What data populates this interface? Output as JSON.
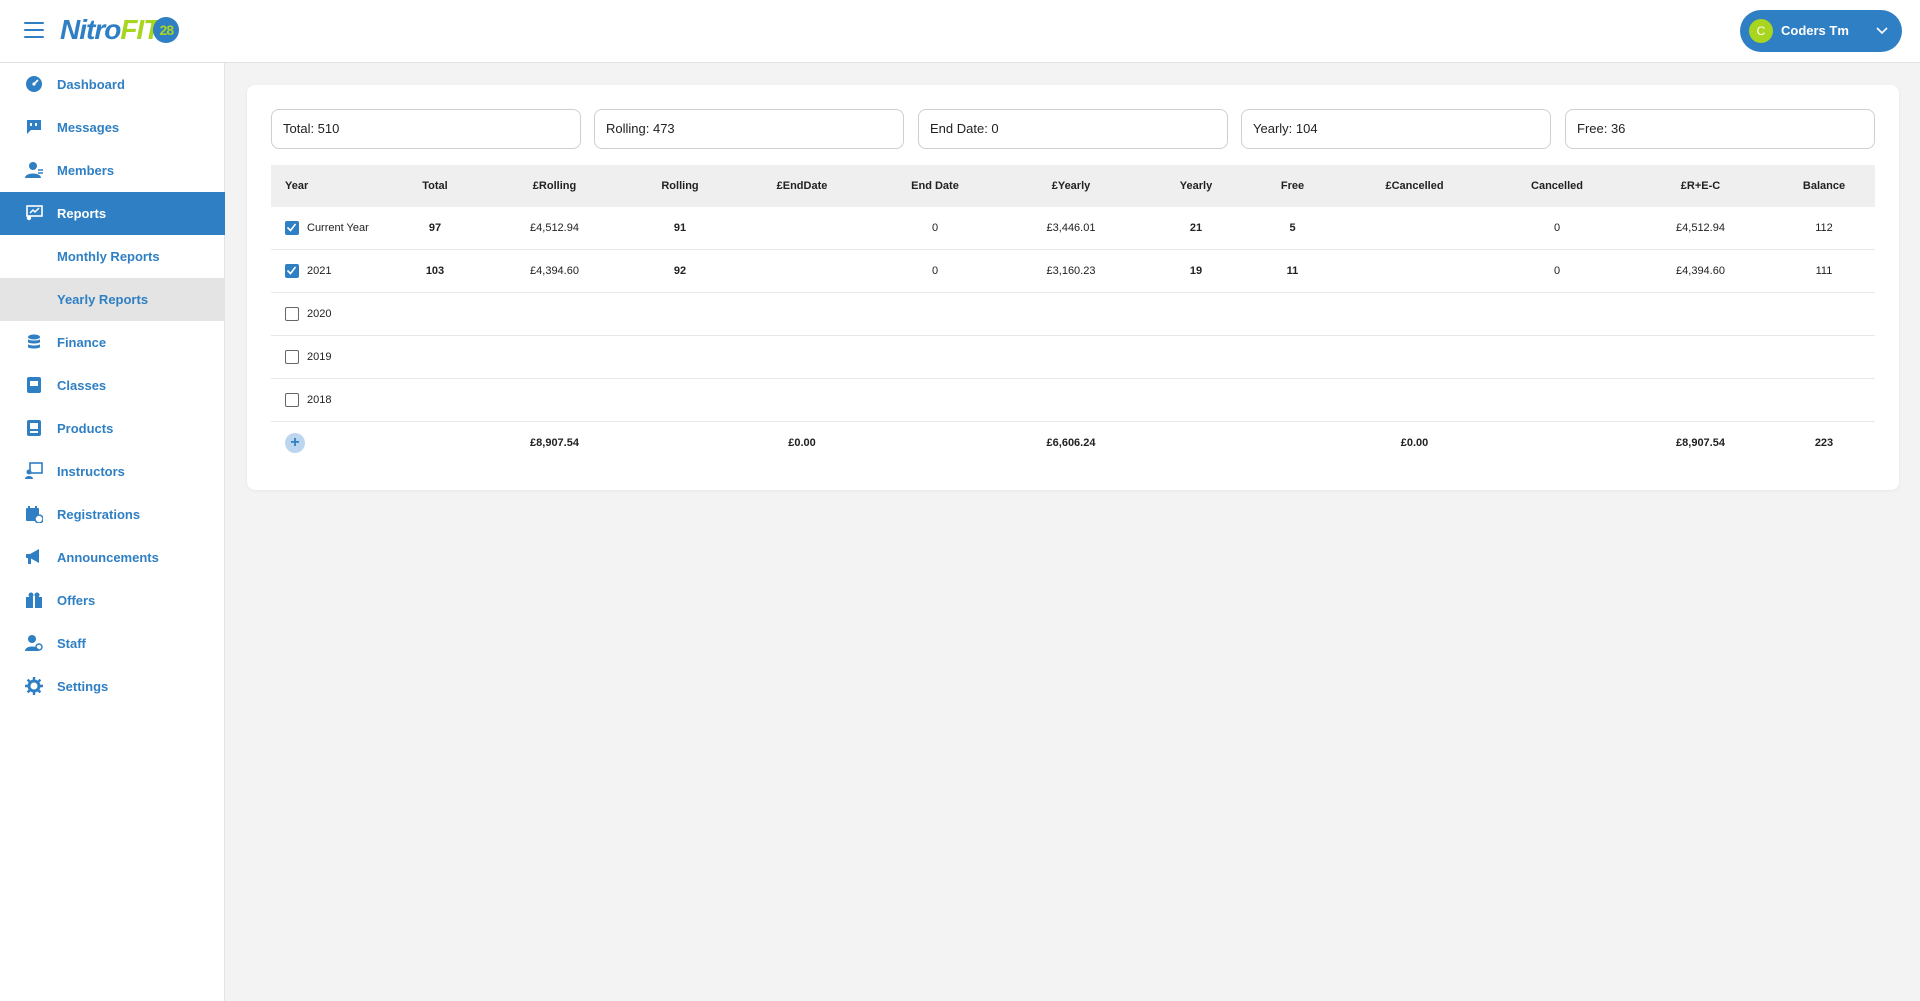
{
  "app": {
    "logo_nitro": "Nitro",
    "logo_fit": "FIT",
    "logo_badge": "28"
  },
  "user": {
    "avatar_initial": "C",
    "name": "Coders Tm"
  },
  "sidebar": {
    "items": [
      {
        "label": "Dashboard",
        "icon": "dashboard-icon"
      },
      {
        "label": "Messages",
        "icon": "messages-icon"
      },
      {
        "label": "Members",
        "icon": "members-icon"
      },
      {
        "label": "Reports",
        "icon": "reports-icon"
      },
      {
        "label": "Monthly Reports"
      },
      {
        "label": "Yearly Reports"
      },
      {
        "label": "Finance",
        "icon": "finance-icon"
      },
      {
        "label": "Classes",
        "icon": "classes-icon"
      },
      {
        "label": "Products",
        "icon": "products-icon"
      },
      {
        "label": "Instructors",
        "icon": "instructors-icon"
      },
      {
        "label": "Registrations",
        "icon": "registrations-icon"
      },
      {
        "label": "Announcements",
        "icon": "announcements-icon"
      },
      {
        "label": "Offers",
        "icon": "offers-icon"
      },
      {
        "label": "Staff",
        "icon": "staff-icon"
      },
      {
        "label": "Settings",
        "icon": "settings-icon"
      }
    ]
  },
  "summary": {
    "total": "Total: 510",
    "rolling": "Rolling: 473",
    "end_date": "End Date: 0",
    "yearly": "Yearly: 104",
    "free": "Free: 36"
  },
  "table": {
    "headers": [
      "Year",
      "Total",
      "£Rolling",
      "Rolling",
      "£EndDate",
      "End Date",
      "£Yearly",
      "Yearly",
      "Free",
      "£Cancelled",
      "Cancelled",
      "£R+E-C",
      "Balance"
    ],
    "rows": [
      {
        "year": "Current Year",
        "checked": true,
        "total": "97",
        "p_rolling": "£4,512.94",
        "rolling": "91",
        "p_enddate": "",
        "end_date": "0",
        "p_yearly": "£3,446.01",
        "yearly": "21",
        "free": "5",
        "p_cancelled": "",
        "cancelled": "0",
        "p_rec": "£4,512.94",
        "balance": "112"
      },
      {
        "year": "2021",
        "checked": true,
        "total": "103",
        "p_rolling": "£4,394.60",
        "rolling": "92",
        "p_enddate": "",
        "end_date": "0",
        "p_yearly": "£3,160.23",
        "yearly": "19",
        "free": "11",
        "p_cancelled": "",
        "cancelled": "0",
        "p_rec": "£4,394.60",
        "balance": "111"
      },
      {
        "year": "2020",
        "checked": false
      },
      {
        "year": "2019",
        "checked": false
      },
      {
        "year": "2018",
        "checked": false
      }
    ],
    "totals": {
      "add_label": "+",
      "p_rolling": "£8,907.54",
      "p_enddate": "£0.00",
      "p_yearly": "£6,606.24",
      "p_cancelled": "£0.00",
      "p_rec": "£8,907.54",
      "balance": "223"
    }
  },
  "colors": {
    "primary": "#2f7fc4",
    "accent": "#a8d51f"
  }
}
